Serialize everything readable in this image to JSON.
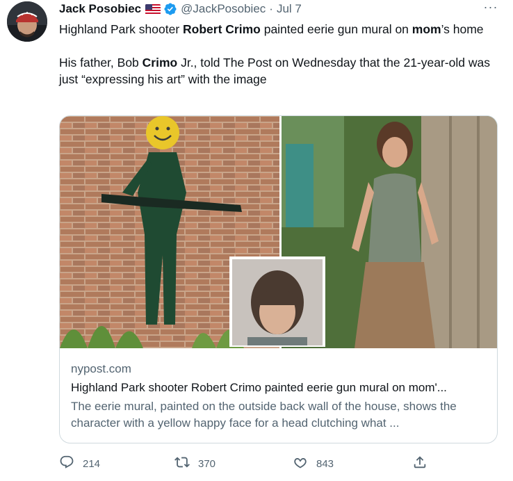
{
  "tweet": {
    "author_name": "Jack Posobiec",
    "author_handle": "@JackPosobiec",
    "separator": "·",
    "date": "Jul 7",
    "more_label": "···",
    "text_p1_a": "Highland Park shooter ",
    "text_p1_b": "Robert Crimo",
    "text_p1_c": " painted eerie gun mural on ",
    "text_p1_d": "mom",
    "text_p1_e": "’s home",
    "text_p2_a": "His father, Bob ",
    "text_p2_b": "Crimo",
    "text_p2_c": " Jr., told The Post on Wednesday that the 21-year-old was just “expressing his art” with the image"
  },
  "card": {
    "domain": "nypost.com",
    "title": "Highland Park shooter Robert Crimo painted eerie gun mural on mom'...",
    "description": "The eerie mural, painted on the outside back wall of the house, shows the character with a yellow happy face for a head clutching what ..."
  },
  "actions": {
    "replies": "214",
    "retweets": "370",
    "likes": "843"
  },
  "icons": {
    "verified": "verified-badge-icon",
    "flag": "us-flag-icon",
    "reply": "reply-icon",
    "retweet": "retweet-icon",
    "like": "heart-icon",
    "share": "share-icon"
  },
  "colors": {
    "verified": "#1d9bf0",
    "secondary_text": "#536471",
    "border": "#cfd9de"
  }
}
